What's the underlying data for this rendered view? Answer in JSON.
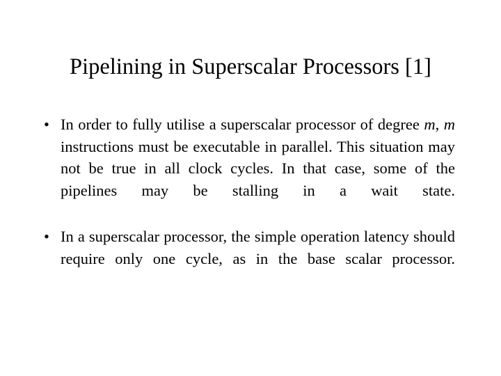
{
  "slide": {
    "title": "Pipelining in Superscalar Processors [1]",
    "background_color": "#ffffff",
    "text_color": "#000000",
    "bullet_glyph": "•",
    "bullets": [
      {
        "marker": "•",
        "segments": [
          {
            "text": "In order to fully utilise a superscalar processor of degree ",
            "style": "normal"
          },
          {
            "text": "m",
            "style": "italic"
          },
          {
            "text": ", ",
            "style": "normal"
          },
          {
            "text": "m",
            "style": "italic"
          },
          {
            "text": " instructions must be executable in parallel. This situation may not be true in all clock cycles. In that case, some of the pipelines may be stalling in a wait state.",
            "style": "normal"
          }
        ],
        "plain_text": "In order to fully utilise a superscalar processor of degree m, m instructions must be executable in parallel. This situation may not be true in all clock cycles. In that case, some of the pipelines may be stalling in a wait state."
      },
      {
        "marker": "•",
        "segments": [
          {
            "text": "In a superscalar processor, the simple operation latency should require only one cycle, as in the base scalar processor.",
            "style": "normal"
          }
        ],
        "plain_text": "In a superscalar processor, the simple operation latency should require only one cycle, as in the base scalar processor."
      }
    ]
  }
}
